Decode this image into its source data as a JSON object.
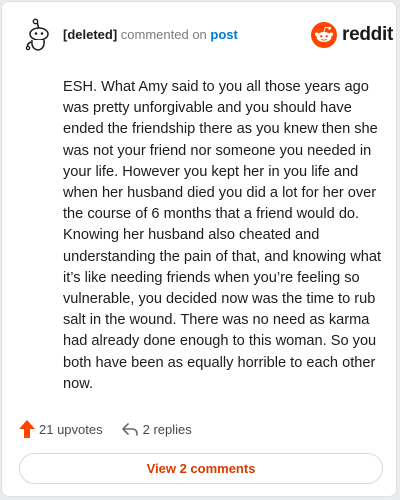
{
  "comment": {
    "author": "[deleted]",
    "meta_text": "commented on",
    "link_text": "post",
    "body": "ESH. What Amy said to you all those years ago was pretty unforgivable and you should have ended the friendship there as you knew then she was not your friend nor someone you needed in your life. However you kept her in you life and when her husband died you did a lot for her over the course of 6 months that a friend would do. Knowing her husband also cheated and understanding the pain of that, and knowing what it’s like needing friends when you’re feeling so vulnerable, you decided now was the time to rub salt in the wound. There was no need as karma had already done enough to this woman. So you both have been as equally horrible to each other now."
  },
  "brand": {
    "name": "reddit",
    "color": "#ff4500"
  },
  "actions": {
    "upvotes_label": "21 upvotes",
    "replies_label": "2 replies"
  },
  "footer": {
    "view_comments_label": "View 2 comments"
  },
  "icons": {
    "avatar": "snoo-avatar-icon",
    "logo": "reddit-logo-icon",
    "upvote": "upvote-arrow-icon",
    "reply": "reply-arrow-icon"
  },
  "colors": {
    "link": "#0079d3",
    "upvote": "#ff4500",
    "view_comments": "#d93a00"
  }
}
